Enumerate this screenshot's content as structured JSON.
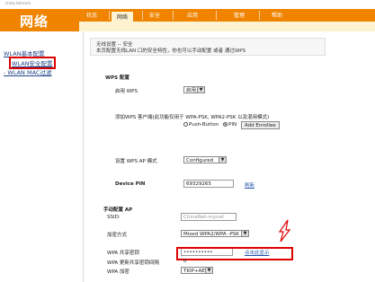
{
  "brand": {
    "logo_text": "china telecom",
    "section_title": "网络"
  },
  "nav": {
    "tabs": [
      "状态",
      "网络",
      "安全",
      "应用",
      "管理",
      "帮助"
    ],
    "active": "网络"
  },
  "sidebar": {
    "items": [
      {
        "label": "WLAN基本配置"
      },
      {
        "label": "WLAN安全配置"
      },
      {
        "label": "- WLAN MAC过滤"
      }
    ]
  },
  "notice": {
    "line1": "无线设置 -- 安全",
    "line2": "本页配置无线LAN 口的安全特性，你也可以手动配置 或者 通过WPS"
  },
  "wps": {
    "section": "WPS 配置",
    "enable_label": "启用 WPS",
    "enable_value": "启用",
    "add_client_label": "添加WPS 客户端(此功能仅用于 WPA-PSK, WPA2-PSK 以及混用模式)",
    "radio_push": "Push-Button",
    "radio_pin": "PIN",
    "add_enrollee": "Add Enrollee",
    "ap_mode_label": "设置 WPS AP 模式",
    "ap_mode_value": "Configured",
    "device_pin_label": "Device PIN",
    "device_pin_value": "69329265",
    "device_pin_link": "刷新"
  },
  "manual": {
    "section": "手动配置 AP",
    "ssid_label": "SSID:",
    "ssid_value": "ChinaNet-mynet",
    "encrypt_label": "加密方式",
    "encrypt_value": "Mixed WPA2/WPA -PSK",
    "key_label": "WPA 共享密钥",
    "key_value": "••••••••••",
    "key_link": "点击此显示",
    "renew_label": "WPA 更新共享密钥间隔",
    "renew_value": "0",
    "wpa_enc_label": "WPA 加密",
    "wpa_enc_value": "TKIP+AES"
  },
  "colors": {
    "brand_orange": "#f08400",
    "highlight_red": "#dd0000",
    "tab_active_bg": "#fdf3d0"
  }
}
